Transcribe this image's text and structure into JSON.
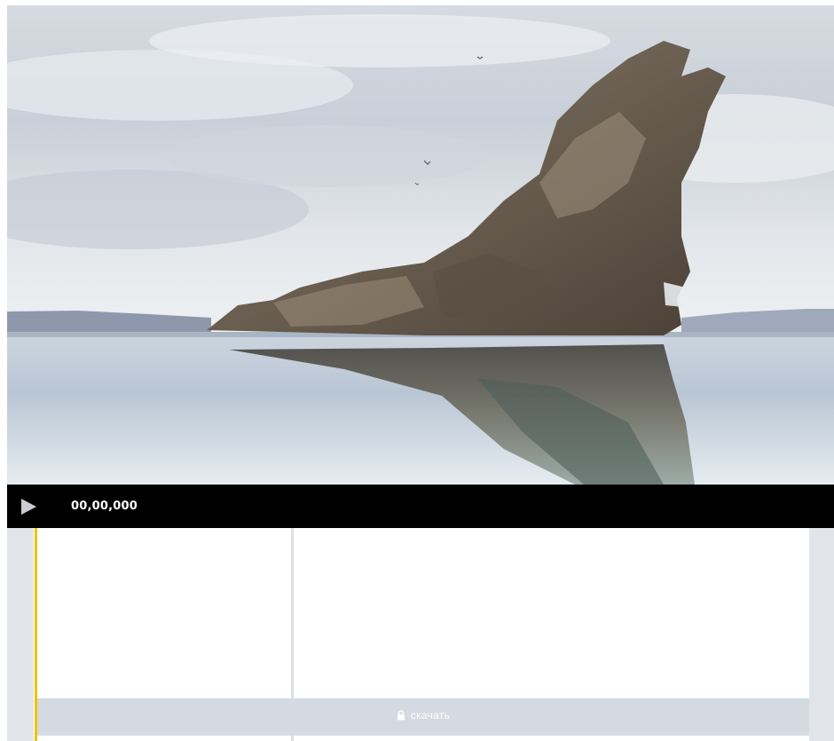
{
  "player": {
    "timecode": "00,00,000",
    "play_icon": "play-icon"
  },
  "timeline": {
    "download_label": "скачать",
    "download_icon": "lock-icon",
    "playhead_color": "#f2c200"
  },
  "colors": {
    "controls_bg": "#000000",
    "gutter": "#e1e5ea",
    "download_strip": "#d4dae2"
  }
}
